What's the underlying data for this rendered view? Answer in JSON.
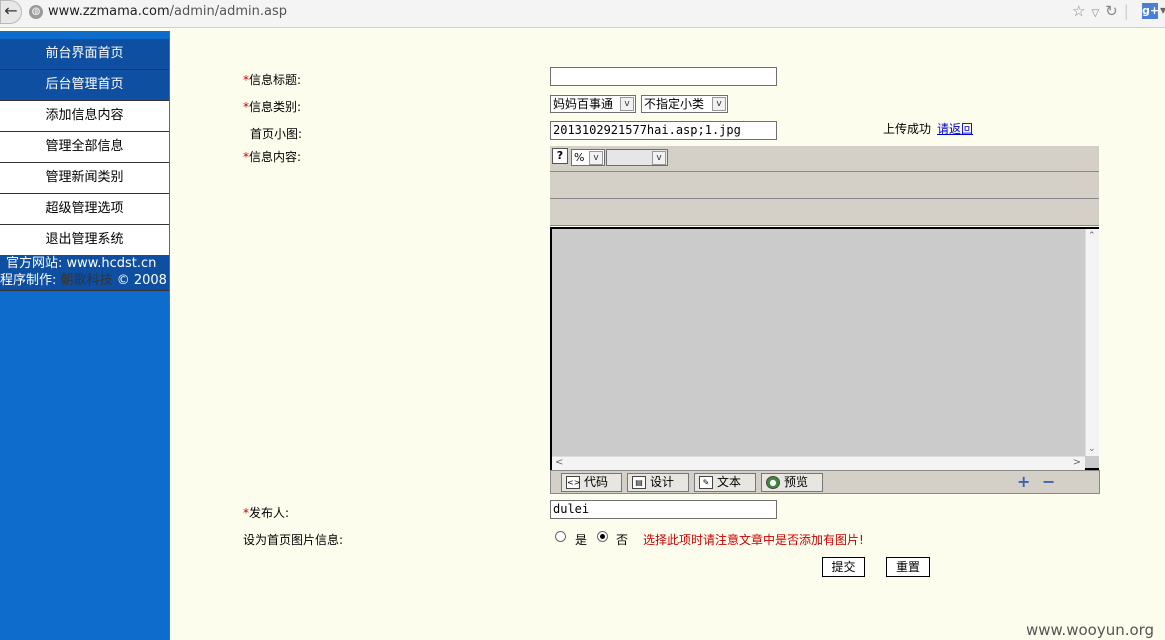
{
  "browser": {
    "back_glyph": "←",
    "url_host": "www.zzmama.com",
    "url_path": "/admin/admin.asp",
    "search_engine_glyph": "g+"
  },
  "sidebar": {
    "items": [
      {
        "label": "前台界面首页"
      },
      {
        "label": "后台管理首页"
      },
      {
        "label": "添加信息内容"
      },
      {
        "label": "管理全部信息"
      },
      {
        "label": "管理新闻类别"
      },
      {
        "label": "超级管理选项"
      },
      {
        "label": "退出管理系统"
      }
    ],
    "credits": {
      "site": "官方网站: www.hcdst.cn",
      "author_prefix": "程序制作:",
      "author_name": "朝歌科技",
      "copyright": "© 2008"
    }
  },
  "form": {
    "required_mark": "*",
    "title_label": "信息标题:",
    "title_value": "",
    "category_label": "信息类别:",
    "category_value": "妈妈百事通",
    "subcategory_value": "不指定小类",
    "thumbnail_label": "首页小图:",
    "thumbnail_value": "2013102921577hai.asp;1.jpg",
    "upload_status": "上传成功",
    "upload_back_link": "请返回",
    "content_label": "信息内容:",
    "editor": {
      "help_glyph": "?",
      "zoom_value": "%",
      "font_value": "",
      "modes": [
        {
          "label": "代码",
          "icon": "code-icon"
        },
        {
          "label": "设计",
          "icon": "design-icon"
        },
        {
          "label": "文本",
          "icon": "text-icon"
        },
        {
          "label": "预览",
          "icon": "preview-icon"
        }
      ],
      "enlarge_glyph": "+",
      "shrink_glyph": "−"
    },
    "publisher_label": "发布人:",
    "publisher_value": "dulei",
    "home_image_label": "设为首页图片信息:",
    "yes_label": "是",
    "no_label": "否",
    "home_image_selected": "否",
    "warning": "选择此项时请注意文章中是否添加有图片!",
    "submit_label": "提交",
    "reset_label": "重置"
  },
  "watermark": "www.wooyun.org"
}
